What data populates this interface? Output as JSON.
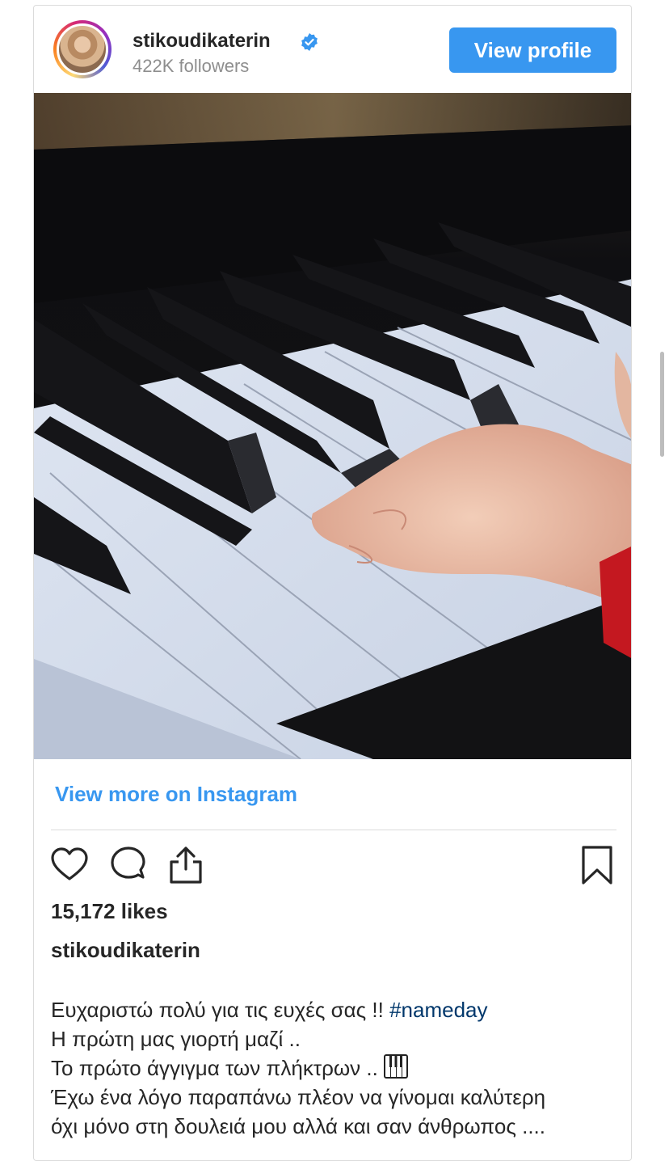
{
  "header": {
    "username": "stikoudikaterin",
    "verified": true,
    "followers": "422K followers",
    "view_profile_label": "View profile"
  },
  "post": {
    "image_description_icon": "photo"
  },
  "links": {
    "view_more": "View more on Instagram"
  },
  "actions": {
    "icons": [
      "heart-icon",
      "comment-icon",
      "share-icon",
      "bookmark-icon"
    ]
  },
  "stats": {
    "likes": "15,172 likes"
  },
  "caption": {
    "username": "stikoudikaterin",
    "line1_text": "Ευχαριστώ πολύ για τις ευχές σας !! ",
    "line1_hashtag": "#nameday",
    "line2": "Η πρώτη μας γιορτή μαζί ..",
    "line3": "Το πρώτο άγγιγμα των πλήκτρων .. ",
    "line4": "Έχω ένα λόγο παραπάνω πλέον να γίνομαι καλύτερη",
    "line5": "όχι μόνο στη δουλειά μου αλλά και σαν άνθρωπος ...."
  },
  "colors": {
    "accent": "#3897f0",
    "text": "#262626",
    "muted": "#8e8e8e",
    "hashtag": "#00376b",
    "border": "#dbdbdb"
  }
}
